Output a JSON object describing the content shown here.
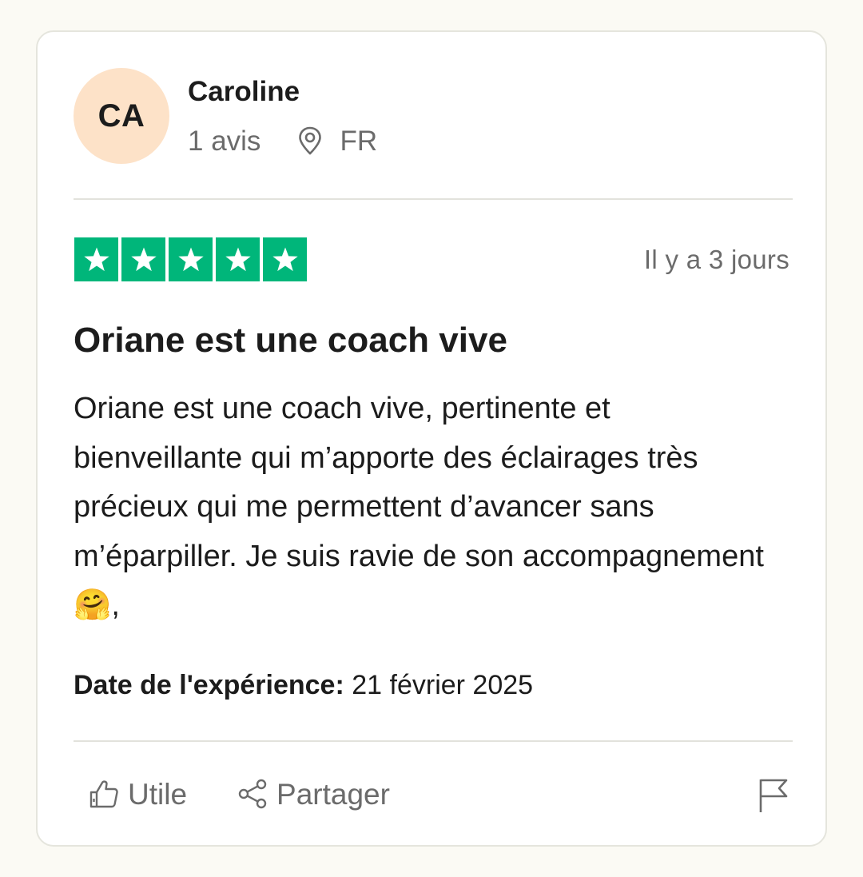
{
  "reviewer": {
    "initials": "CA",
    "name": "Caroline",
    "review_count": "1 avis",
    "country": "FR"
  },
  "review": {
    "rating": 5,
    "max_rating": 5,
    "star_color": "#00b67a",
    "posted": "Il y a 3 jours",
    "title": "Oriane est une coach vive",
    "body": "Oriane est une coach vive, pertinente et bienveillante qui m’apporte des éclairages très précieux qui me permettent d’avancer sans m’éparpiller. Je suis ravie de son accompagnement 🤗,",
    "experience_label": "Date de l'expérience:",
    "experience_date": "21 février 2025"
  },
  "actions": {
    "useful_label": "Utile",
    "share_label": "Partager",
    "flag_icon": "flag-icon"
  },
  "colors": {
    "avatar_bg": "#fde2c8",
    "muted_text": "#6b6b6b"
  }
}
